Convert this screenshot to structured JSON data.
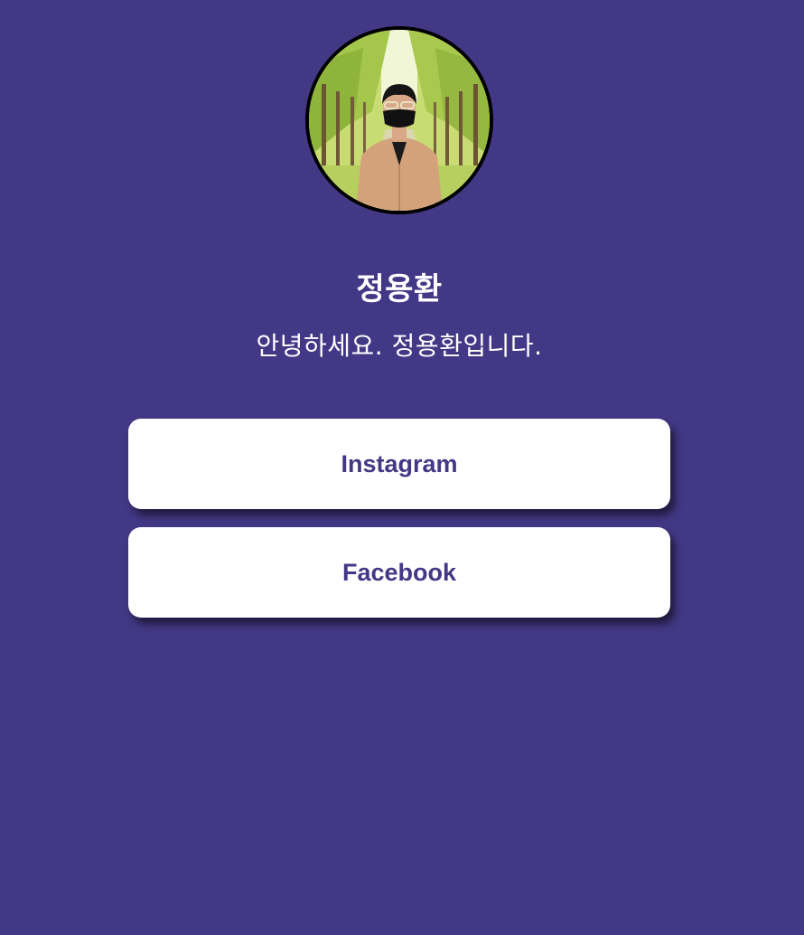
{
  "profile": {
    "name": "정용환",
    "bio": "안녕하세요. 정용환입니다."
  },
  "links": [
    {
      "label": "Instagram"
    },
    {
      "label": "Facebook"
    }
  ],
  "colors": {
    "background": "#433885",
    "button_background": "#ffffff",
    "button_text": "#433885",
    "heading_text": "#ffffff"
  }
}
